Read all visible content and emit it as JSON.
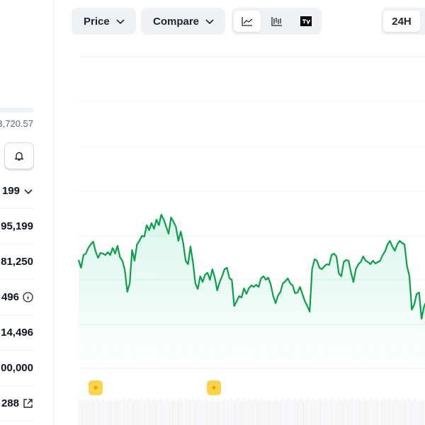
{
  "sidebar": {
    "price_partial": "3,720.57",
    "rows": [
      {
        "value": "199",
        "icon": "chevron-down-icon"
      },
      {
        "value": "95,199"
      },
      {
        "value": "81,250"
      },
      {
        "value": "496",
        "icon": "info-icon"
      },
      {
        "value": "14,496"
      },
      {
        "value": "00,000"
      },
      {
        "value": "288",
        "icon": "external-link-icon"
      }
    ]
  },
  "toolbar": {
    "price_label": "Price",
    "compare_label": "Compare",
    "chart_types": [
      "line-chart-icon",
      "candlestick-chart-icon",
      "tradingview-icon"
    ],
    "active_chart_type": "line-chart-icon",
    "range_label": "24H"
  },
  "colors": {
    "line": "#16c784",
    "line_stroke": "#0aa04a",
    "marker": "#fcd34d"
  },
  "chart_data": {
    "type": "line",
    "title": "",
    "grid": true,
    "values": [
      153,
      142,
      160,
      162,
      170,
      175,
      179,
      165,
      156,
      163,
      162,
      160,
      164,
      160,
      170,
      162,
      173,
      157,
      152,
      139,
      108,
      120,
      167,
      152,
      175,
      180,
      187,
      186,
      202,
      195,
      205,
      197,
      210,
      202,
      217,
      210,
      200,
      190,
      213,
      207,
      200,
      180,
      193,
      177,
      152,
      147,
      172,
      150,
      120,
      112,
      130,
      122,
      132,
      135,
      125,
      140,
      128,
      110,
      122,
      130,
      140,
      142,
      127,
      125,
      88,
      95,
      102,
      100,
      113,
      105,
      113,
      117,
      115,
      118,
      115,
      127,
      130,
      125,
      128,
      118,
      102,
      92,
      103,
      108,
      120,
      123,
      127,
      120,
      117,
      106,
      107,
      115,
      105,
      95,
      88,
      80,
      140,
      154,
      152,
      142,
      140,
      144,
      147,
      146,
      160,
      162,
      158,
      134,
      130,
      150,
      153,
      152,
      135,
      122,
      140,
      147,
      150,
      158,
      152,
      150,
      147,
      152,
      148,
      150,
      152,
      160,
      165,
      175,
      180,
      172,
      166,
      175,
      180,
      177,
      175,
      145,
      130,
      83,
      90,
      105,
      107,
      70,
      87,
      95
    ],
    "event_markers": 2
  }
}
